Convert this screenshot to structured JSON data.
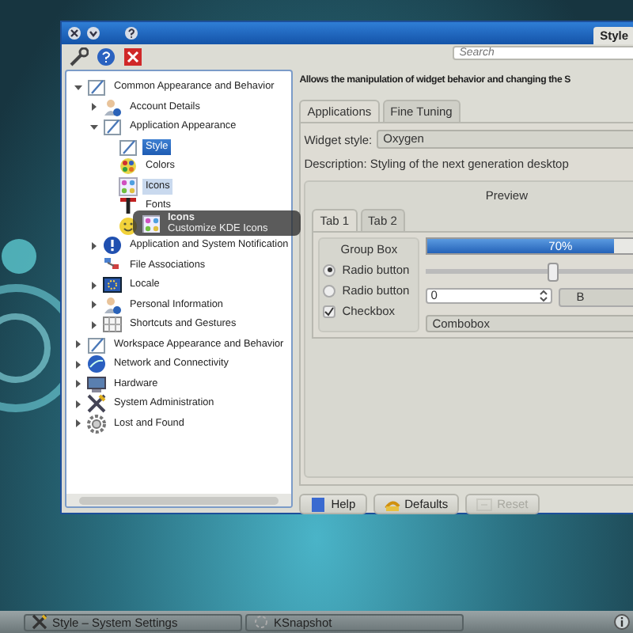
{
  "window": {
    "title": "Style",
    "search": {
      "placeholder": "Search"
    }
  },
  "tree": [
    {
      "label": "Common Appearance and Behavior",
      "kind": "appearance",
      "expanded": true,
      "selected": false,
      "hovered": false,
      "children": [
        {
          "label": "Account Details",
          "kind": "user",
          "expanded": false,
          "selected": false,
          "hovered": false
        },
        {
          "label": "Application Appearance",
          "kind": "appearance",
          "expanded": true,
          "selected": false,
          "hovered": false,
          "children": [
            {
              "label": "Style",
              "kind": "appearance",
              "selected": true,
              "hovered": false
            },
            {
              "label": "Colors",
              "kind": "colors",
              "selected": false,
              "hovered": false
            },
            {
              "label": "Icons",
              "kind": "icons",
              "selected": false,
              "hovered": true
            },
            {
              "label": "Fonts",
              "kind": "fonts",
              "selected": false,
              "hovered": false
            },
            {
              "kind": "emoticons",
              "selected": false,
              "hovered": false
            }
          ]
        },
        {
          "label": "Application and System Notification",
          "kind": "notify",
          "expanded": false,
          "selected": false,
          "hovered": false
        },
        {
          "label": "File Associations",
          "kind": "files",
          "selected": false,
          "hovered": false
        },
        {
          "label": "Locale",
          "kind": "locale",
          "expanded": false,
          "selected": false,
          "hovered": false
        },
        {
          "label": "Personal Information",
          "kind": "user",
          "expanded": false,
          "selected": false,
          "hovered": false
        },
        {
          "label": "Shortcuts and Gestures",
          "kind": "shortcuts",
          "expanded": false,
          "selected": false,
          "hovered": false
        }
      ]
    },
    {
      "label": "Workspace Appearance and Behavior",
      "kind": "appearance",
      "expanded": false,
      "selected": false,
      "hovered": false
    },
    {
      "label": "Network and Connectivity",
      "kind": "network",
      "expanded": false,
      "selected": false,
      "hovered": false
    },
    {
      "label": "Hardware",
      "kind": "hardware",
      "expanded": false,
      "selected": false,
      "hovered": false
    },
    {
      "label": "System Administration",
      "kind": "admin",
      "expanded": false,
      "selected": false,
      "hovered": false
    },
    {
      "label": "Lost and Found",
      "kind": "gear",
      "expanded": false,
      "selected": false,
      "hovered": false
    }
  ],
  "tooltip": {
    "title": "Icons",
    "text": "Customize KDE Icons"
  },
  "module": {
    "description": "Allows the manipulation of widget behavior and changing the S",
    "tabs": [
      {
        "label": "Applications",
        "selected": true
      },
      {
        "label": "Fine Tuning",
        "selected": false
      }
    ],
    "widget_style": {
      "label": "Widget style:",
      "value": "Oxygen"
    },
    "style_description": "Description: Styling of the next generation desktop",
    "preview": {
      "title": "Preview",
      "tabs": [
        {
          "label": "Tab 1",
          "selected": true
        },
        {
          "label": "Tab 2",
          "selected": false
        }
      ],
      "group_box": "Group Box",
      "radios": [
        {
          "label": "Radio button",
          "selected": true
        },
        {
          "label": "Radio button",
          "selected": false
        }
      ],
      "checkbox": {
        "label": "Checkbox",
        "checked": true
      },
      "progress": {
        "level": 0.7,
        "text": "70%"
      },
      "slider": {
        "level": 0.45
      },
      "spinbox": "0",
      "button": "B",
      "combobox": "Combobox"
    }
  },
  "buttons": [
    {
      "label": "Help",
      "kind": "help",
      "disabled": false
    },
    {
      "label": "Defaults",
      "kind": "defaults",
      "disabled": false
    },
    {
      "label": "Reset",
      "kind": "reset",
      "disabled": true
    }
  ],
  "taskbar": [
    {
      "label": "Style – System Settings",
      "kind": "settings"
    },
    {
      "label": "KSnapshot",
      "kind": "snapshot"
    }
  ]
}
